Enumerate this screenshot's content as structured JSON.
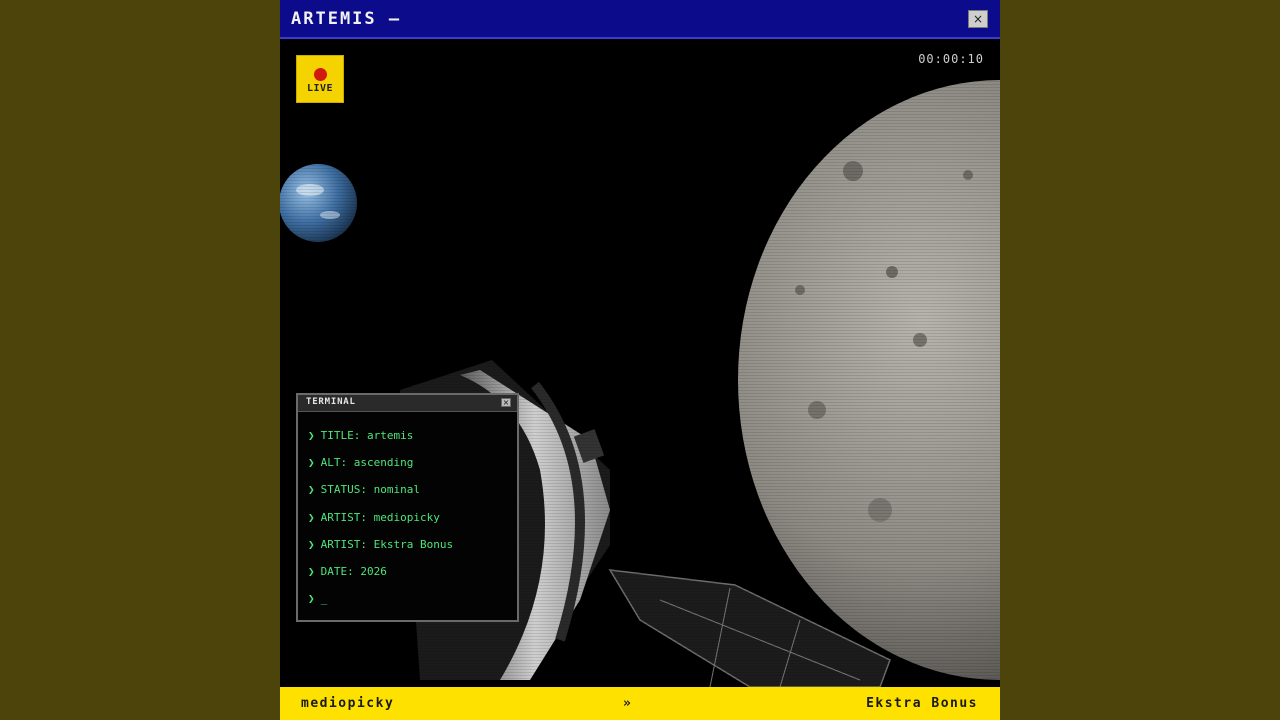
{
  "window": {
    "title": "ARTEMIS —",
    "close_label": "×"
  },
  "overlay": {
    "live_label": "LIVE",
    "timer": "00:00:10"
  },
  "terminal": {
    "title": "TERMINAL",
    "close_label": "×",
    "prompt_symbol": "❯",
    "lines": [
      "TITLE: artemis",
      "ALT: ascending",
      "STATUS: nominal",
      "ARTIST: mediopicky",
      "ARTIST: Ekstra Bonus",
      "DATE: 2026"
    ],
    "cursor": "_"
  },
  "footer": {
    "left": "mediopicky",
    "separator": "»",
    "right": "Ekstra Bonus"
  },
  "colors": {
    "titlebar": "#0b0b8c",
    "live_badge": "#f5d300",
    "live_dot": "#d11a0e",
    "terminal_text": "#4ee57c",
    "footer": "#ffe100",
    "page_background": "#4d440b"
  }
}
